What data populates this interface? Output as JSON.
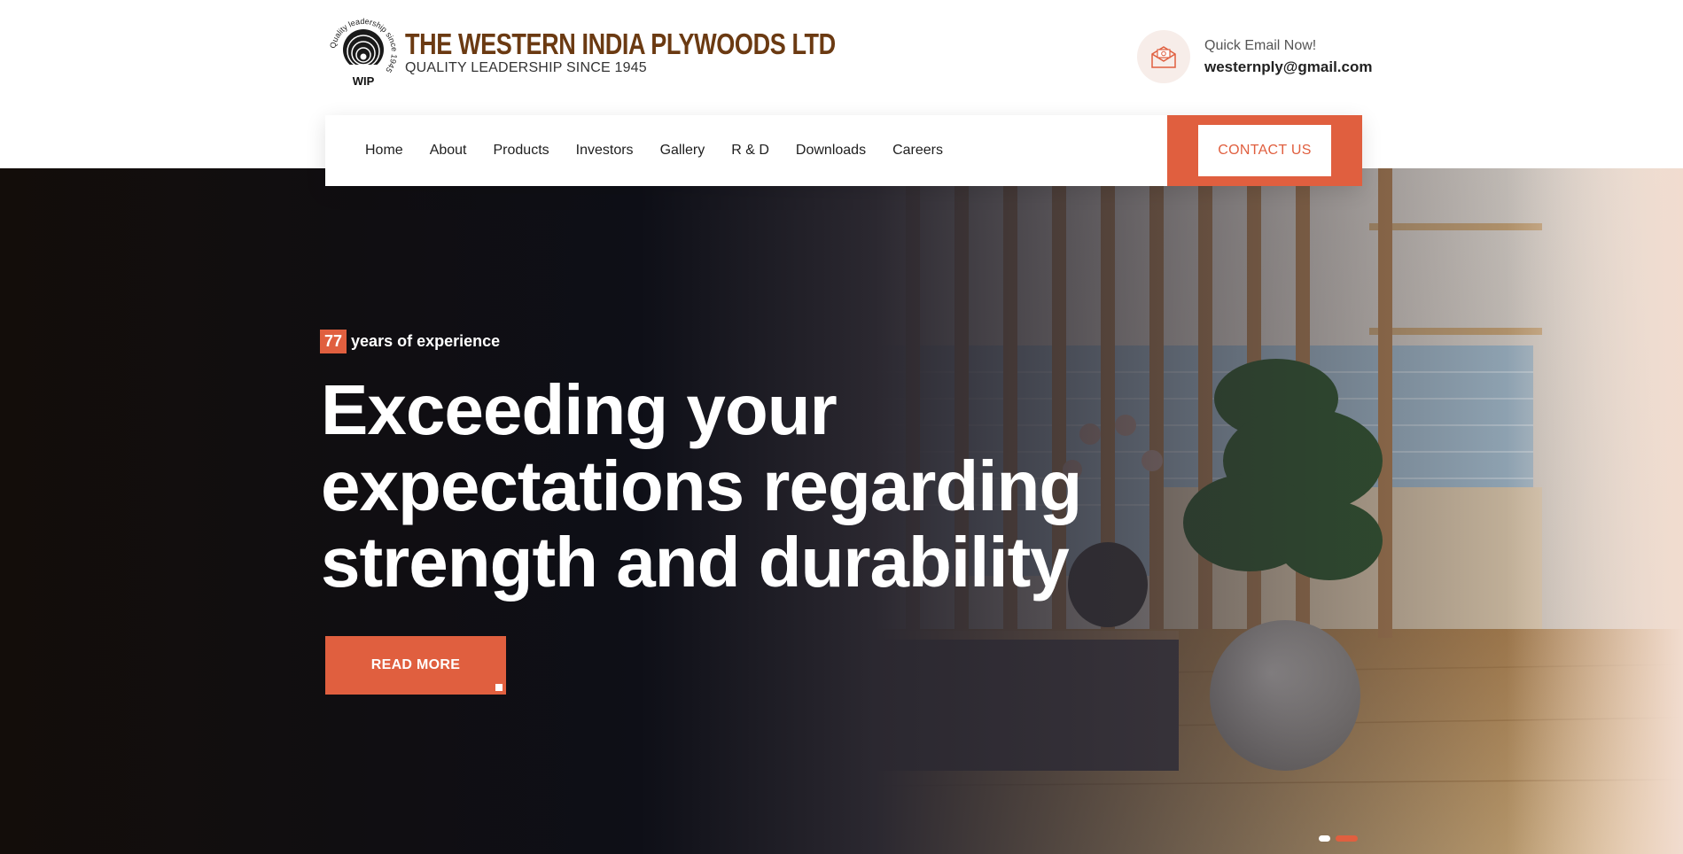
{
  "brand": {
    "title": "THE WESTERN INDIA PLYWOODS LTD",
    "subtitle": "QUALITY LEADERSHIP SINCE 1945",
    "logo_ring_text": "Quality leadership since 1945",
    "logo_initials": "WIP"
  },
  "contact": {
    "label": "Quick Email Now!",
    "email": "westernply@gmail.com"
  },
  "nav": {
    "items": [
      {
        "label": "Home"
      },
      {
        "label": "About"
      },
      {
        "label": "Products"
      },
      {
        "label": "Investors"
      },
      {
        "label": "Gallery"
      },
      {
        "label": "R & D"
      },
      {
        "label": "Downloads"
      },
      {
        "label": "Careers"
      }
    ],
    "contact_button": "CONTACT US"
  },
  "hero": {
    "years_badge": "77",
    "years_text": "years of experience",
    "headline_line1": "Exceeding your",
    "headline_line2": "expectations regarding",
    "headline_line3": "strength and durability",
    "cta": "READ MORE",
    "slides": [
      {
        "active": false
      },
      {
        "active": true
      }
    ]
  },
  "colors": {
    "accent": "#e05f3f",
    "brand_brown": "#6b3a12",
    "hero_dark": "#140f0c"
  }
}
